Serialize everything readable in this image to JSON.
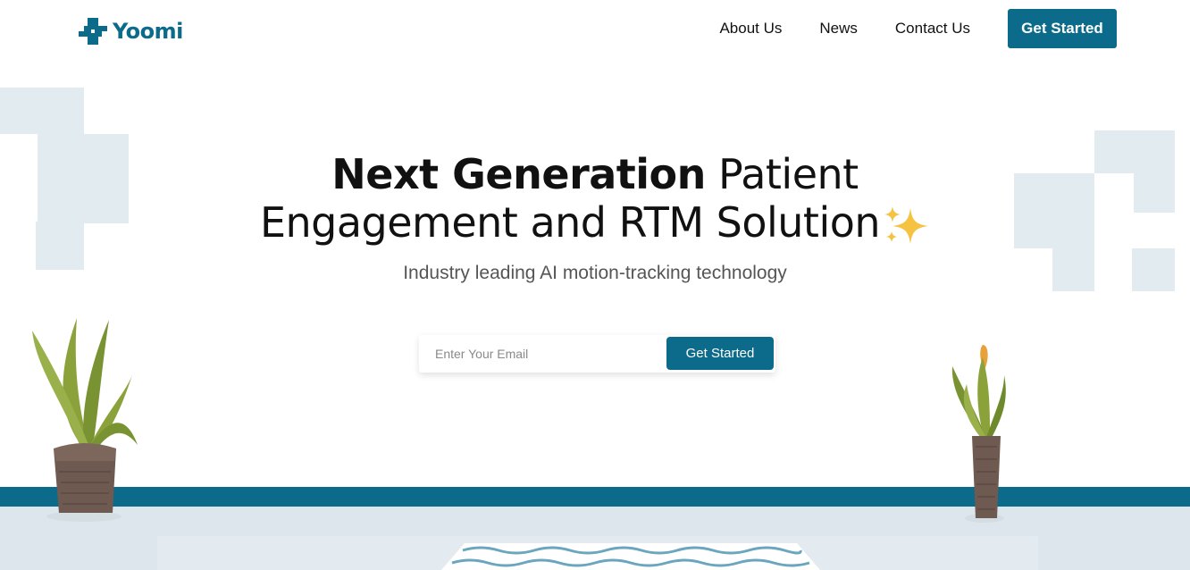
{
  "brand": {
    "name": "Yoomi",
    "accent_color": "#0c6a8a",
    "logo_icon": "medical-cross-icon"
  },
  "nav": {
    "links": [
      "About Us",
      "News",
      "Contact Us"
    ],
    "cta_label": "Get Started"
  },
  "hero": {
    "title_bold": "Next Generation",
    "title_rest_line1": "Patient",
    "title_line2": "Engagement and RTM Solution",
    "title_icon": "sparkles-icon",
    "subtitle": "Industry leading AI motion-tracking technology"
  },
  "signup": {
    "email_placeholder": "Enter Your Email",
    "submit_label": "Get Started"
  },
  "decorations": {
    "left_plant": "plant-icon",
    "right_plant": "plant-icon",
    "rug": "rug-icon"
  }
}
